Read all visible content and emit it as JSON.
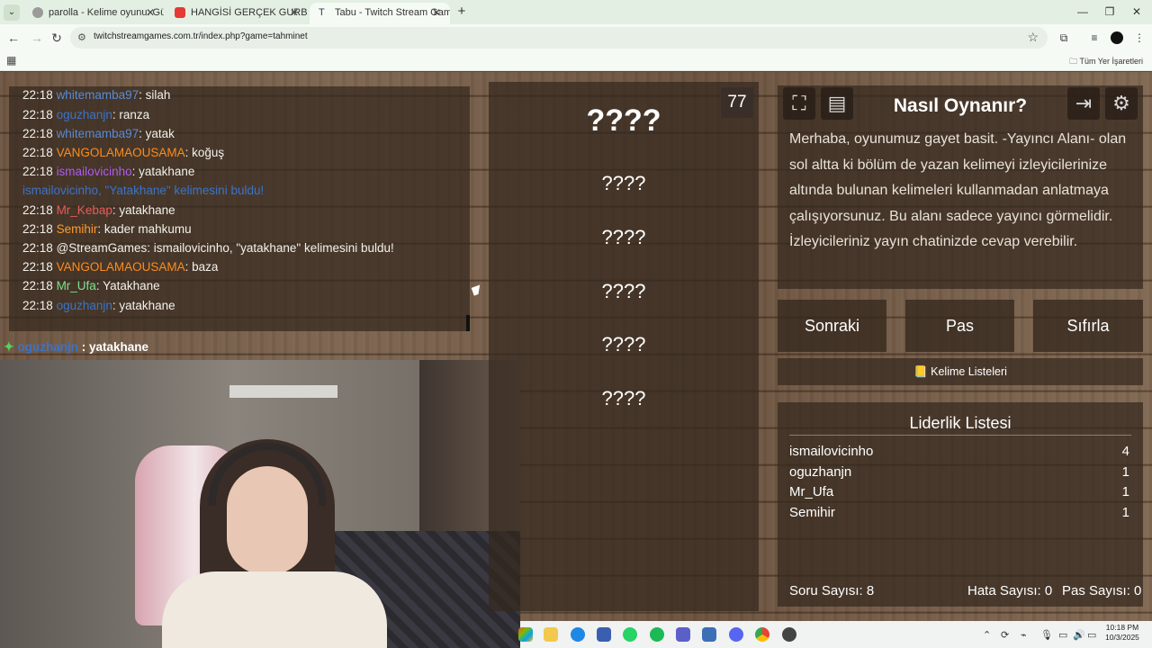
{
  "browser": {
    "tabs": [
      {
        "title": "parolla - Kelime oyunu. Günlük",
        "favicon_color": "#9a9a9a"
      },
      {
        "title": "HANGİSİ GERÇEK GURBETÇİ?! #",
        "favicon_color": "#e53935"
      },
      {
        "title": "Tabu - Twitch Stream Games",
        "favicon_color": "#2c3e50"
      }
    ],
    "new_tab": "+",
    "url": "twitchstreamgames.com.tr/index.php?game=tahminet",
    "bookmarks_all": "Tüm Yer İşaretleri"
  },
  "chat": {
    "lines": [
      {
        "time": "22:18",
        "user": "whitemamba97",
        "color": "#5b8bd6",
        "text": ": silah"
      },
      {
        "time": "22:18",
        "user": "oguzhanjn",
        "color": "#3b73c8",
        "text": ": ranza"
      },
      {
        "time": "22:18",
        "user": "whitemamba97",
        "color": "#5b8bd6",
        "text": ": yatak"
      },
      {
        "time": "22:18",
        "user": "VANGOLAMAOUSAMA",
        "color": "#ff8c1a",
        "text": ": koğuş"
      },
      {
        "time": "22:18",
        "user": "ismailovicinho",
        "color": "#b05cf0",
        "text": ": yatakhane"
      },
      {
        "time": "",
        "user": "ismailovicinho, \"Yatakhane\" kelimesini buldu!",
        "color": "#3b73c8",
        "text": ""
      },
      {
        "time": "22:18",
        "user": "Mr_Kebap",
        "color": "#e85a5a",
        "text": ": yatakhane"
      },
      {
        "time": "22:18",
        "user": "Semihir",
        "color": "#ff9a2e",
        "text": ": kader mahkumu"
      },
      {
        "time": "22:18",
        "user": "@StreamGames",
        "color": "#f3f0ea",
        "text": ": ismailovicinho, \"yatakhane\" kelimesini buldu!"
      },
      {
        "time": "22:18",
        "user": "VANGOLAMAOUSAMA",
        "color": "#ff8c1a",
        "text": ": baza"
      },
      {
        "time": "22:18",
        "user": "Mr_Ufa",
        "color": "#7ee08a",
        "text": ": Yatakhane"
      },
      {
        "time": "22:18",
        "user": "oguzhanjn",
        "color": "#3b73c8",
        "text": ": yatakhane"
      }
    ],
    "overlay": {
      "star": "✦",
      "user": "oguzhanjn",
      "text": " : yatakhane"
    }
  },
  "game": {
    "timer": "77",
    "main_word": "????",
    "forbidden_words": [
      "????",
      "????",
      "????",
      "????",
      "????"
    ]
  },
  "howto": {
    "title": "Nasıl Oynanır?",
    "text": "Merhaba, oyunumuz gayet basit. -Yayıncı Alanı- olan sol altta ki bölüm de yazan kelimeyi izleyicilerinize altında bulunan kelimeleri kullanmadan anlatmaya çalışıyorsunuz. Bu alanı sadece yayıncı görmelidir. İzleyicileriniz yayın chatinizde cevap verebilir."
  },
  "controls": {
    "next": "Sonraki",
    "pass": "Pas",
    "reset": "Sıfırla",
    "word_lists": "📒 Kelime Listeleri"
  },
  "leaderboard": {
    "title": "Liderlik Listesi",
    "rows": [
      {
        "name": "ismailovicinho",
        "score": "4"
      },
      {
        "name": "oguzhanjn",
        "score": "1"
      },
      {
        "name": "Mr_Ufa",
        "score": "1"
      },
      {
        "name": "Semihir",
        "score": "1"
      }
    ]
  },
  "stats": {
    "questions": "Soru Sayısı: 8",
    "errors": "Hata Sayısı: 0",
    "passes": "Pas Sayısı: 0"
  },
  "taskbar": {
    "time": "10:18 PM",
    "date": "10/3/2025"
  }
}
